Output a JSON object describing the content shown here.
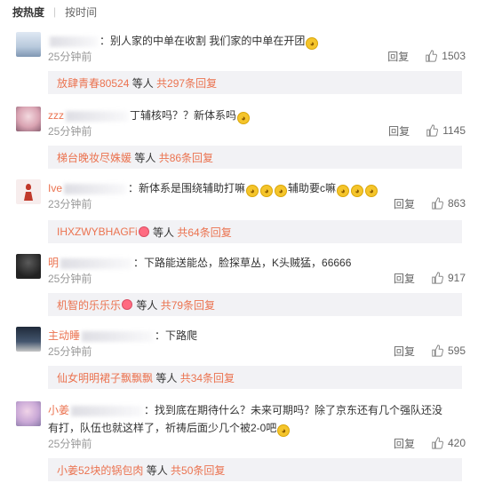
{
  "sort": {
    "hot": "按热度",
    "time": "按时间"
  },
  "comments": [
    {
      "user": "",
      "text": "：别人家的中单在收割 我们家的中单在开团",
      "time": "25分钟前",
      "reply": "回复",
      "likes": "1503",
      "sub_user": "放肆青春80524",
      "sub_mid": " 等人 ",
      "sub_total": "共297条回复",
      "avatar_color": "#c8d6e8"
    },
    {
      "user": "zzz",
      "text": "丁辅核吗？？新体系吗",
      "time": "25分钟前",
      "reply": "回复",
      "likes": "1145",
      "sub_user": "梯台晚妆尽姝媛",
      "sub_mid": " 等人 ",
      "sub_total": "共86条回复",
      "avatar_color": "#d6a3b0"
    },
    {
      "user": "Ive",
      "text": "：新体系是围绕辅助打嘛",
      "text2": "辅助要c嘛",
      "time": "23分钟前",
      "reply": "回复",
      "likes": "863",
      "sub_user": "IHXZWYBHAGFi",
      "sub_mid": " 等人 ",
      "sub_total": "共64条回复",
      "avatar_color": "#f3e3e3"
    },
    {
      "user": "明",
      "text": "：下路能送能怂，脸探草丛，K头贼猛，66666",
      "time": "25分钟前",
      "reply": "回复",
      "likes": "917",
      "sub_user": "机智的乐乐乐",
      "sub_mid": " 等人 ",
      "sub_total": "共79条回复",
      "avatar_color": "#3a3a3a"
    },
    {
      "user": "主动睡",
      "text": "：下路爬",
      "time": "25分钟前",
      "reply": "回复",
      "likes": "595",
      "sub_user": "仙女明明裙子飘飘飘",
      "sub_mid": " 等人 ",
      "sub_total": "共34条回复",
      "avatar_color": "#2e3a4a"
    },
    {
      "user": "小姜",
      "text": "：找到底在期待什么？未来可期吗？除了京东还有几个强队还没",
      "text2": "有打，队伍也就这样了，祈祷后面少几个被2-0吧",
      "time": "25分钟前",
      "reply": "回复",
      "likes": "420",
      "sub_user": "小姜52块的锅包肉",
      "sub_mid": " 等人 ",
      "sub_total": "共50条回复",
      "avatar_color": "#c9a8d6"
    }
  ]
}
